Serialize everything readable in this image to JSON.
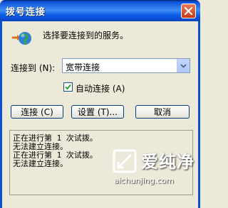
{
  "window": {
    "title": "拨号连接"
  },
  "dialog": {
    "prompt": "选择要连接到的服务。",
    "connect_to_label": "连接到 (N):",
    "connect_to_value": "宽带连接",
    "auto_connect_label": "自动连接 (A)",
    "auto_connect_checked": true
  },
  "buttons": {
    "connect": "连接 (C)",
    "settings": "设置 (T)...",
    "cancel": "取消"
  },
  "log": {
    "lines": [
      "正在进行第 1 次试拨。",
      "无法建立连接。",
      "正在进行第 1 次试拨。",
      "无法建立连接。"
    ]
  },
  "watermark": {
    "name": "爱纯净",
    "url": "aichunjing.com"
  },
  "icons": {
    "close": "close-icon",
    "network": "network-globe-icon",
    "dropdown": "chevron-down-icon",
    "check": "checkmark-icon"
  },
  "colors": {
    "titlebar": "#0b4fd8",
    "close_button": "#d8501c",
    "dialog_background": "#ece9d8"
  }
}
